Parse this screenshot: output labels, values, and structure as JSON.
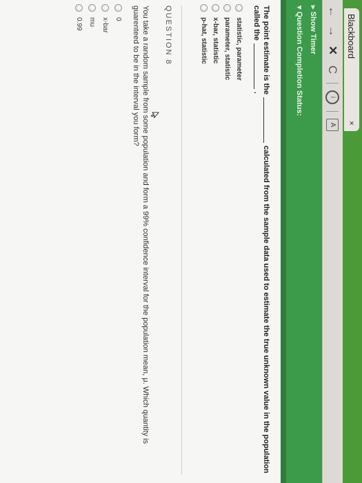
{
  "browser": {
    "tab_title": "Blackboard",
    "tab_close": "×",
    "back": "←",
    "forward": "→",
    "stop": "✕",
    "reload": "C",
    "info_glyph": "i",
    "ext_glyph": "A"
  },
  "status": {
    "show_timer": "▸ Show Timer",
    "completion": "▾ Question Completion Status:"
  },
  "question7": {
    "text_before": "The point estimate is the",
    "text_after": "calculated from the sample data used to estimate the true unknown value in the population called the",
    "text_end": ".",
    "options": [
      "statistic, parameter",
      "parameter, statistic",
      "x-bar, statistic",
      "p-hat, statistic"
    ]
  },
  "question8": {
    "label": "QUESTION 8",
    "text": "You take a random sample from some population and form a 99% confidence interval for the population mean, μ. Which quantity is guarenteed to be in the interval you form?",
    "options": [
      "0",
      "x-bar",
      "mu",
      "0.99"
    ]
  }
}
